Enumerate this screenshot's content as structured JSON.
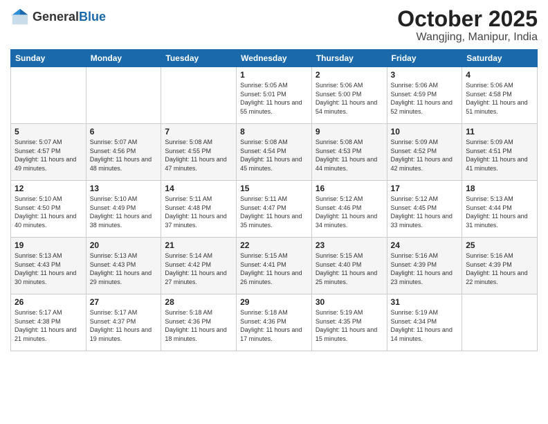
{
  "header": {
    "logo_general": "General",
    "logo_blue": "Blue",
    "month_title": "October 2025",
    "subtitle": "Wangjing, Manipur, India"
  },
  "days_of_week": [
    "Sunday",
    "Monday",
    "Tuesday",
    "Wednesday",
    "Thursday",
    "Friday",
    "Saturday"
  ],
  "weeks": [
    [
      {
        "day": "",
        "sunrise": "",
        "sunset": "",
        "daylight": ""
      },
      {
        "day": "",
        "sunrise": "",
        "sunset": "",
        "daylight": ""
      },
      {
        "day": "",
        "sunrise": "",
        "sunset": "",
        "daylight": ""
      },
      {
        "day": "1",
        "sunrise": "Sunrise: 5:05 AM",
        "sunset": "Sunset: 5:01 PM",
        "daylight": "Daylight: 11 hours and 55 minutes."
      },
      {
        "day": "2",
        "sunrise": "Sunrise: 5:06 AM",
        "sunset": "Sunset: 5:00 PM",
        "daylight": "Daylight: 11 hours and 54 minutes."
      },
      {
        "day": "3",
        "sunrise": "Sunrise: 5:06 AM",
        "sunset": "Sunset: 4:59 PM",
        "daylight": "Daylight: 11 hours and 52 minutes."
      },
      {
        "day": "4",
        "sunrise": "Sunrise: 5:06 AM",
        "sunset": "Sunset: 4:58 PM",
        "daylight": "Daylight: 11 hours and 51 minutes."
      }
    ],
    [
      {
        "day": "5",
        "sunrise": "Sunrise: 5:07 AM",
        "sunset": "Sunset: 4:57 PM",
        "daylight": "Daylight: 11 hours and 49 minutes."
      },
      {
        "day": "6",
        "sunrise": "Sunrise: 5:07 AM",
        "sunset": "Sunset: 4:56 PM",
        "daylight": "Daylight: 11 hours and 48 minutes."
      },
      {
        "day": "7",
        "sunrise": "Sunrise: 5:08 AM",
        "sunset": "Sunset: 4:55 PM",
        "daylight": "Daylight: 11 hours and 47 minutes."
      },
      {
        "day": "8",
        "sunrise": "Sunrise: 5:08 AM",
        "sunset": "Sunset: 4:54 PM",
        "daylight": "Daylight: 11 hours and 45 minutes."
      },
      {
        "day": "9",
        "sunrise": "Sunrise: 5:08 AM",
        "sunset": "Sunset: 4:53 PM",
        "daylight": "Daylight: 11 hours and 44 minutes."
      },
      {
        "day": "10",
        "sunrise": "Sunrise: 5:09 AM",
        "sunset": "Sunset: 4:52 PM",
        "daylight": "Daylight: 11 hours and 42 minutes."
      },
      {
        "day": "11",
        "sunrise": "Sunrise: 5:09 AM",
        "sunset": "Sunset: 4:51 PM",
        "daylight": "Daylight: 11 hours and 41 minutes."
      }
    ],
    [
      {
        "day": "12",
        "sunrise": "Sunrise: 5:10 AM",
        "sunset": "Sunset: 4:50 PM",
        "daylight": "Daylight: 11 hours and 40 minutes."
      },
      {
        "day": "13",
        "sunrise": "Sunrise: 5:10 AM",
        "sunset": "Sunset: 4:49 PM",
        "daylight": "Daylight: 11 hours and 38 minutes."
      },
      {
        "day": "14",
        "sunrise": "Sunrise: 5:11 AM",
        "sunset": "Sunset: 4:48 PM",
        "daylight": "Daylight: 11 hours and 37 minutes."
      },
      {
        "day": "15",
        "sunrise": "Sunrise: 5:11 AM",
        "sunset": "Sunset: 4:47 PM",
        "daylight": "Daylight: 11 hours and 35 minutes."
      },
      {
        "day": "16",
        "sunrise": "Sunrise: 5:12 AM",
        "sunset": "Sunset: 4:46 PM",
        "daylight": "Daylight: 11 hours and 34 minutes."
      },
      {
        "day": "17",
        "sunrise": "Sunrise: 5:12 AM",
        "sunset": "Sunset: 4:45 PM",
        "daylight": "Daylight: 11 hours and 33 minutes."
      },
      {
        "day": "18",
        "sunrise": "Sunrise: 5:13 AM",
        "sunset": "Sunset: 4:44 PM",
        "daylight": "Daylight: 11 hours and 31 minutes."
      }
    ],
    [
      {
        "day": "19",
        "sunrise": "Sunrise: 5:13 AM",
        "sunset": "Sunset: 4:43 PM",
        "daylight": "Daylight: 11 hours and 30 minutes."
      },
      {
        "day": "20",
        "sunrise": "Sunrise: 5:13 AM",
        "sunset": "Sunset: 4:43 PM",
        "daylight": "Daylight: 11 hours and 29 minutes."
      },
      {
        "day": "21",
        "sunrise": "Sunrise: 5:14 AM",
        "sunset": "Sunset: 4:42 PM",
        "daylight": "Daylight: 11 hours and 27 minutes."
      },
      {
        "day": "22",
        "sunrise": "Sunrise: 5:15 AM",
        "sunset": "Sunset: 4:41 PM",
        "daylight": "Daylight: 11 hours and 26 minutes."
      },
      {
        "day": "23",
        "sunrise": "Sunrise: 5:15 AM",
        "sunset": "Sunset: 4:40 PM",
        "daylight": "Daylight: 11 hours and 25 minutes."
      },
      {
        "day": "24",
        "sunrise": "Sunrise: 5:16 AM",
        "sunset": "Sunset: 4:39 PM",
        "daylight": "Daylight: 11 hours and 23 minutes."
      },
      {
        "day": "25",
        "sunrise": "Sunrise: 5:16 AM",
        "sunset": "Sunset: 4:39 PM",
        "daylight": "Daylight: 11 hours and 22 minutes."
      }
    ],
    [
      {
        "day": "26",
        "sunrise": "Sunrise: 5:17 AM",
        "sunset": "Sunset: 4:38 PM",
        "daylight": "Daylight: 11 hours and 21 minutes."
      },
      {
        "day": "27",
        "sunrise": "Sunrise: 5:17 AM",
        "sunset": "Sunset: 4:37 PM",
        "daylight": "Daylight: 11 hours and 19 minutes."
      },
      {
        "day": "28",
        "sunrise": "Sunrise: 5:18 AM",
        "sunset": "Sunset: 4:36 PM",
        "daylight": "Daylight: 11 hours and 18 minutes."
      },
      {
        "day": "29",
        "sunrise": "Sunrise: 5:18 AM",
        "sunset": "Sunset: 4:36 PM",
        "daylight": "Daylight: 11 hours and 17 minutes."
      },
      {
        "day": "30",
        "sunrise": "Sunrise: 5:19 AM",
        "sunset": "Sunset: 4:35 PM",
        "daylight": "Daylight: 11 hours and 15 minutes."
      },
      {
        "day": "31",
        "sunrise": "Sunrise: 5:19 AM",
        "sunset": "Sunset: 4:34 PM",
        "daylight": "Daylight: 11 hours and 14 minutes."
      },
      {
        "day": "",
        "sunrise": "",
        "sunset": "",
        "daylight": ""
      }
    ]
  ]
}
